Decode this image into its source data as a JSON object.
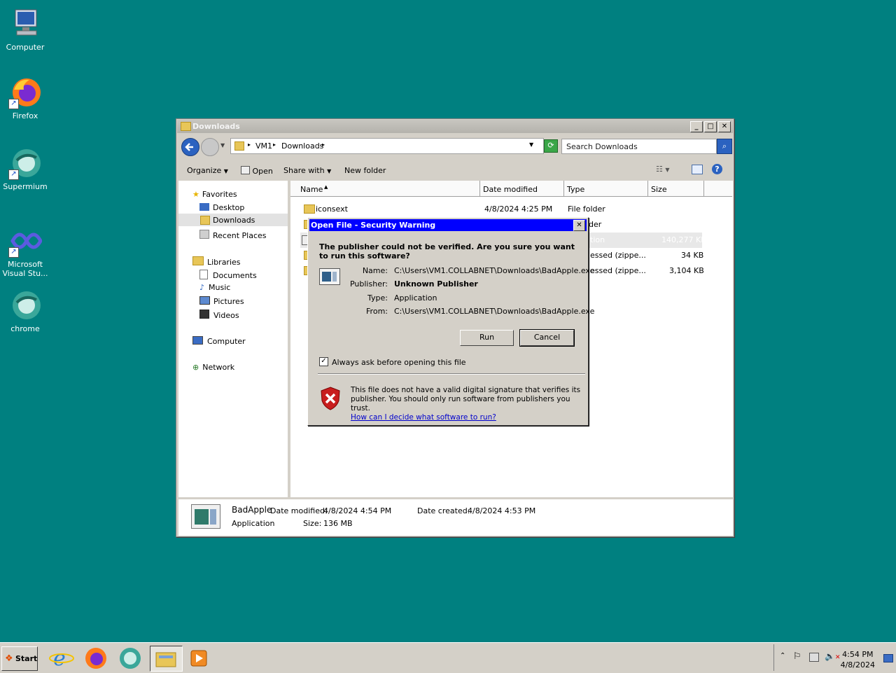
{
  "desktop": {
    "icons": [
      {
        "label": "Computer",
        "icon": "computer-icon"
      },
      {
        "label": "Firefox",
        "icon": "firefox-icon"
      },
      {
        "label": "Supermium",
        "icon": "supermium-icon"
      },
      {
        "label": "Microsoft Visual Stu...",
        "icon": "visual-studio-icon"
      },
      {
        "label": "chrome",
        "icon": "chrome-icon"
      }
    ]
  },
  "explorer": {
    "title": "Downloads",
    "address": {
      "segment1": "VM1",
      "segment2": "Downloads"
    },
    "search_placeholder": "Search Downloads",
    "toolbar": {
      "organize": "Organize",
      "open": "Open",
      "share_with": "Share with",
      "new_folder": "New folder"
    },
    "nav": {
      "favorites": "Favorites",
      "desktop": "Desktop",
      "downloads": "Downloads",
      "recent": "Recent Places",
      "libraries": "Libraries",
      "documents": "Documents",
      "music": "Music",
      "pictures": "Pictures",
      "videos": "Videos",
      "computer": "Computer",
      "network": "Network"
    },
    "columns": {
      "name": "Name",
      "date": "Date modified",
      "type": "Type",
      "size": "Size"
    },
    "rows": [
      {
        "name": "iconsext",
        "date": "4/8/2024 4:25 PM",
        "type": "File folder",
        "size": ""
      },
      {
        "name": "",
        "date": "",
        "type": "der",
        "size": ""
      },
      {
        "name": "",
        "date": "",
        "type": "tion",
        "size": "140,277 KB"
      },
      {
        "name": "",
        "date": "",
        "type": "essed (zippe...",
        "size": "34 KB"
      },
      {
        "name": "",
        "date": "",
        "type": "essed (zippe...",
        "size": "3,104 KB"
      }
    ],
    "details": {
      "name": "BadApple",
      "kind": "Application",
      "date_modified_label": "Date modified:",
      "date_modified": "4/8/2024 4:54 PM",
      "size_label": "Size:",
      "size": "136 MB",
      "date_created_label": "Date created:",
      "date_created": "4/8/2024 4:53 PM"
    }
  },
  "dialog": {
    "title": "Open File - Security Warning",
    "question": "The publisher could not be verified.  Are you sure you want to run this software?",
    "name_label": "Name:",
    "name": "C:\\Users\\VM1.COLLABNET\\Downloads\\BadApple.exe",
    "publisher_label": "Publisher:",
    "publisher": "Unknown Publisher",
    "type_label": "Type:",
    "type": "Application",
    "from_label": "From:",
    "from": "C:\\Users\\VM1.COLLABNET\\Downloads\\BadApple.exe",
    "run": "Run",
    "cancel": "Cancel",
    "always_ask": "Always ask before opening this file",
    "always_ask_checked": true,
    "warning": "This file does not have a valid digital signature that verifies its publisher.  You should only run software from publishers you trust.",
    "link": "How can I decide what software to run?"
  },
  "taskbar": {
    "start": "Start",
    "time": "4:54 PM",
    "date": "4/8/2024"
  }
}
